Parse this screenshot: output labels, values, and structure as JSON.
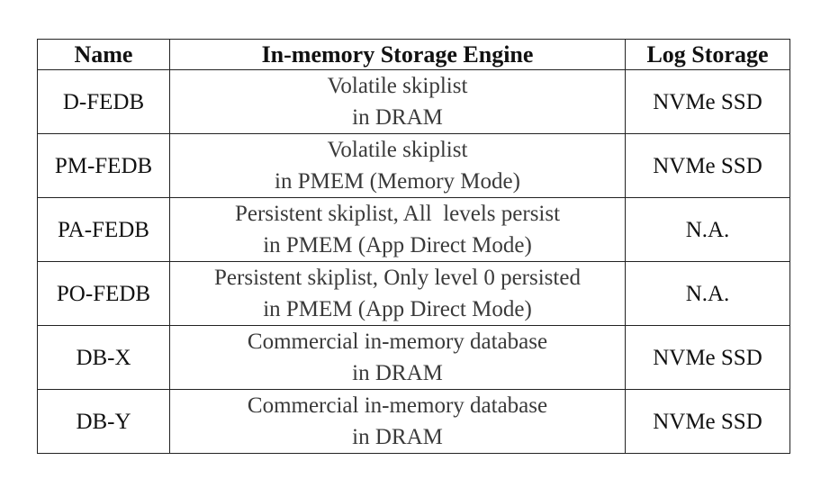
{
  "table": {
    "headers": {
      "name": "Name",
      "engine": "In-memory Storage Engine",
      "log": "Log Storage"
    },
    "rows": [
      {
        "name": "D-FEDB",
        "engine_line1": "Volatile skiplist",
        "engine_line2": "in DRAM",
        "log": "NVMe SSD"
      },
      {
        "name": "PM-FEDB",
        "engine_line1": "Volatile skiplist",
        "engine_line2": "in PMEM (Memory Mode)",
        "log": "NVMe SSD"
      },
      {
        "name": "PA-FEDB",
        "engine_line1": "Persistent skiplist, All  levels persist",
        "engine_line2": "in PMEM (App Direct Mode)",
        "log": "N.A."
      },
      {
        "name": "PO-FEDB",
        "engine_line1": "Persistent skiplist, Only level 0 persisted",
        "engine_line2": "in PMEM (App Direct Mode)",
        "log": "N.A."
      },
      {
        "name": "DB-X",
        "engine_line1": "Commercial in-memory database",
        "engine_line2": "in DRAM",
        "log": "NVMe SSD"
      },
      {
        "name": "DB-Y",
        "engine_line1": "Commercial in-memory database",
        "engine_line2": "in DRAM",
        "log": "NVMe SSD"
      }
    ]
  }
}
